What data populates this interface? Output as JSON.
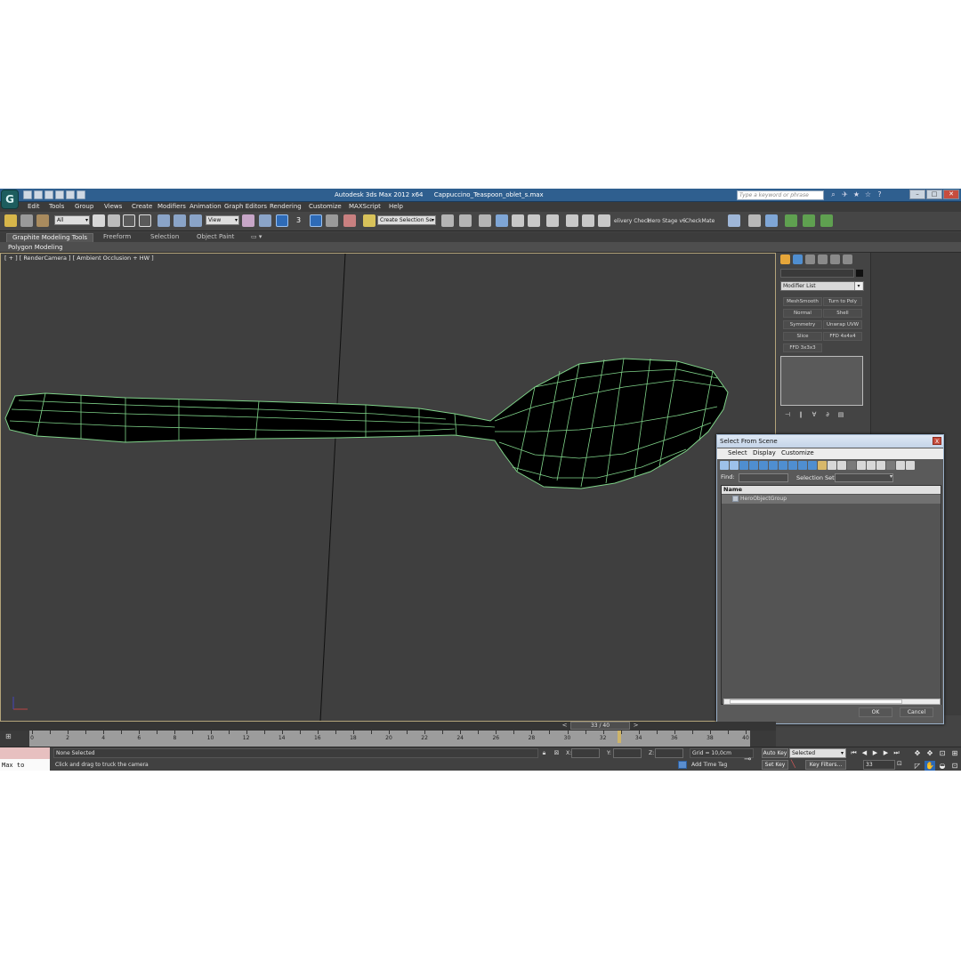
{
  "window": {
    "app_title": "Autodesk 3ds Max  2012 x64",
    "file_name": "Cappuccino_Teaspoon_oblet_s.max",
    "search_placeholder": "Type a keyword or phrase",
    "logo_text": "G"
  },
  "menu": [
    "Edit",
    "Tools",
    "Group",
    "Views",
    "Create",
    "Modifiers",
    "Animation",
    "Graph Editors",
    "Rendering",
    "Customize",
    "MAXScript",
    "Help"
  ],
  "toolbar": {
    "filter_value": "All",
    "ref_coord_value": "View",
    "snap_label": "3",
    "selection_set_value": "Create Selection Se",
    "plugin_labels": [
      "elivery Check",
      "Hero Stage v6",
      "CheckMate"
    ]
  },
  "ribbon": {
    "tabs": [
      "Graphite Modeling Tools",
      "Freeform",
      "Selection",
      "Object Paint"
    ],
    "active_tab": "Graphite Modeling Tools",
    "panel_label": "Polygon Modeling"
  },
  "viewport": {
    "label": "[ + ] [ RenderCamera ] [ Ambient Occlusion + HW ]",
    "wire_color": "#7fd389",
    "object_fill": "#000000"
  },
  "command_panel": {
    "modifier_list_label": "Modifier List",
    "modifier_buttons": [
      "MeshSmooth",
      "Turn to Poly",
      "Normal",
      "Shell",
      "Symmetry",
      "Unwrap UVW",
      "Slice",
      "FFD 4x4x4",
      "FFD 3x3x3"
    ]
  },
  "dialog": {
    "title": "Select From Scene",
    "close_label": "X",
    "menu": [
      "Select",
      "Display",
      "Customize"
    ],
    "find_label": "Find:",
    "selection_set_label": "Selection Set:",
    "column_header": "Name",
    "rows": [
      "HeroObjectGroup"
    ],
    "ok_label": "OK",
    "cancel_label": "Cancel"
  },
  "timeline": {
    "frame_display": "33 / 40",
    "current_frame": 33,
    "ruler_labels": [
      "0",
      "2",
      "4",
      "6",
      "8",
      "10",
      "12",
      "14",
      "16",
      "18",
      "20",
      "22",
      "24",
      "26",
      "28",
      "30",
      "32",
      "34",
      "36",
      "38",
      "40"
    ]
  },
  "status": {
    "maxscript_value": "Max to Physc.",
    "selection_status": "None Selected",
    "prompt": "Click and drag to truck the camera",
    "x_label": "X:",
    "y_label": "Y:",
    "z_label": "Z:",
    "grid": "Grid = 10,0cm",
    "add_time_tag": "Add Time Tag",
    "auto_key_label": "Auto Key",
    "set_key_label": "Set Key",
    "key_mode_value": "Selected",
    "key_filters_label": "Key Filters...",
    "frame_value": "33"
  }
}
